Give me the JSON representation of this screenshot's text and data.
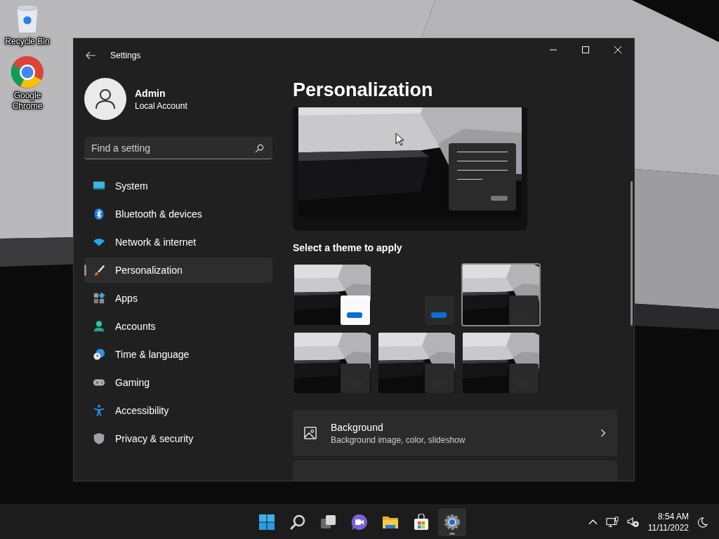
{
  "desktop": {
    "icons": [
      {
        "label": "Recycle Bin",
        "kind": "recycle"
      },
      {
        "label": "Google Chrome",
        "kind": "chrome"
      }
    ]
  },
  "window": {
    "title": "Settings"
  },
  "profile": {
    "name": "Admin",
    "account_type": "Local Account"
  },
  "search": {
    "placeholder": "Find a setting"
  },
  "sidebar": {
    "items": [
      {
        "label": "System",
        "kind": "system",
        "selected": false
      },
      {
        "label": "Bluetooth & devices",
        "kind": "bluetooth",
        "selected": false
      },
      {
        "label": "Network & internet",
        "kind": "network",
        "selected": false
      },
      {
        "label": "Personalization",
        "kind": "brush",
        "selected": true
      },
      {
        "label": "Apps",
        "kind": "apps",
        "selected": false
      },
      {
        "label": "Accounts",
        "kind": "accounts",
        "selected": false
      },
      {
        "label": "Time & language",
        "kind": "time",
        "selected": false
      },
      {
        "label": "Gaming",
        "kind": "gaming",
        "selected": false
      },
      {
        "label": "Accessibility",
        "kind": "accessibility",
        "selected": false
      },
      {
        "label": "Privacy & security",
        "kind": "privacy",
        "selected": false
      }
    ]
  },
  "page": {
    "title": "Personalization",
    "section_heading": "Select a theme to apply",
    "themes": [
      {
        "kind": "light",
        "selected": false
      },
      {
        "kind": "dark",
        "selected": false
      },
      {
        "kind": "picture",
        "selected": true
      },
      {
        "kind": "picture",
        "selected": false
      },
      {
        "kind": "picture",
        "selected": false
      },
      {
        "kind": "picture",
        "selected": false
      }
    ],
    "cards": [
      {
        "title": "Background",
        "subtitle": "Background image, color, slideshow"
      }
    ]
  },
  "taskbar": {
    "apps": [
      {
        "kind": "start",
        "active": false
      },
      {
        "kind": "search",
        "active": false
      },
      {
        "kind": "taskview",
        "active": false
      },
      {
        "kind": "chat",
        "active": false
      },
      {
        "kind": "explorer",
        "active": false
      },
      {
        "kind": "store",
        "active": false
      },
      {
        "kind": "settings",
        "active": true
      }
    ],
    "clock": {
      "time": "8:54 AM",
      "date": "11/11/2022"
    }
  }
}
